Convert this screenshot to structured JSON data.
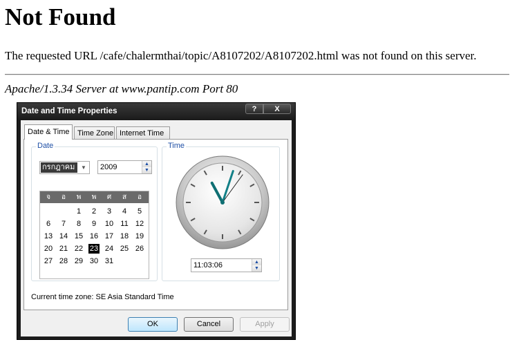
{
  "page": {
    "heading": "Not Found",
    "message": "The requested URL /cafe/chalermthai/topic/A8107202/A8107202.html was not found on this server.",
    "address": "Apache/1.3.34 Server at www.pantip.com Port 80"
  },
  "dialog": {
    "title": "Date and Time Properties",
    "help_label": "?",
    "close_label": "X",
    "tabs": [
      {
        "label": "Date & Time",
        "active": true
      },
      {
        "label": "Time Zone",
        "active": false
      },
      {
        "label": "Internet Time",
        "active": false
      }
    ],
    "date_group_label": "Date",
    "month_value": "กรกฎาคม",
    "year_value": "2009",
    "weekday_headers": [
      "จ",
      "อ",
      "พ",
      "พ",
      "ศ",
      "ส",
      "อ"
    ],
    "weeks": [
      [
        "",
        "",
        "1",
        "2",
        "3",
        "4",
        "5"
      ],
      [
        "6",
        "7",
        "8",
        "9",
        "10",
        "11",
        "12"
      ],
      [
        "13",
        "14",
        "15",
        "16",
        "17",
        "18",
        "19"
      ],
      [
        "20",
        "21",
        "22",
        "23",
        "24",
        "25",
        "26"
      ],
      [
        "27",
        "28",
        "29",
        "30",
        "31",
        "",
        ""
      ]
    ],
    "selected_day": "23",
    "time_group_label": "Time",
    "time_value": "11:03:06",
    "clock": {
      "hour": 11,
      "minute": 3,
      "second": 6
    },
    "timezone_text": "Current time zone:  SE Asia Standard Time",
    "buttons": {
      "ok": "OK",
      "cancel": "Cancel",
      "apply": "Apply"
    }
  }
}
